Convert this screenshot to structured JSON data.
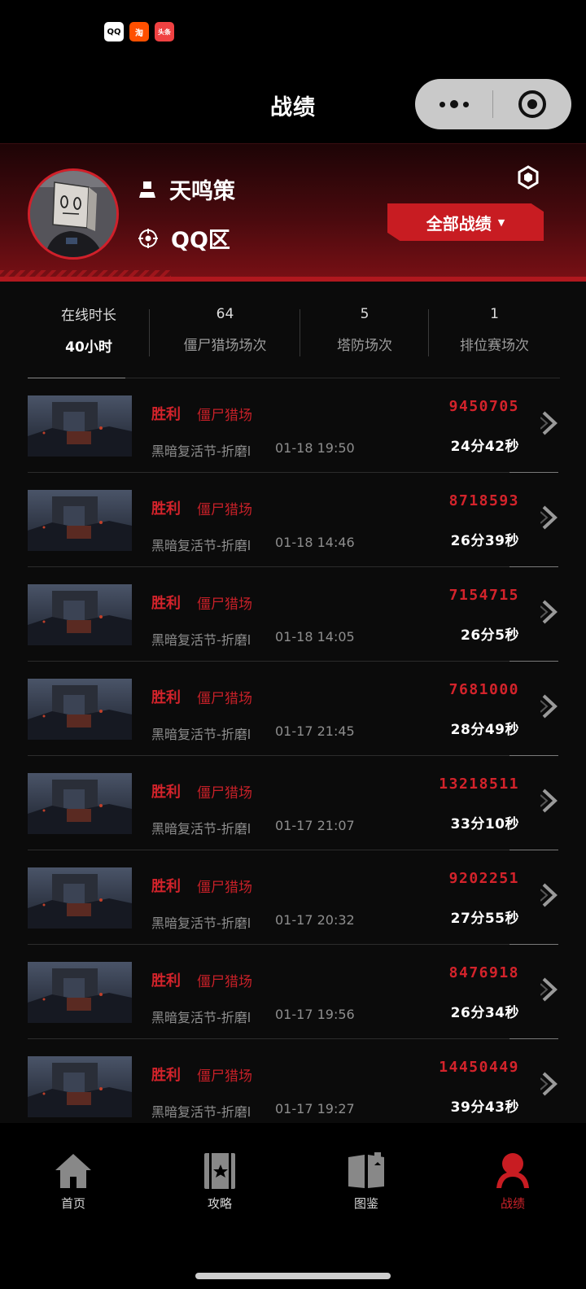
{
  "status_bar": {
    "icons": [
      {
        "name": "qq-app-icon",
        "text": "QQ"
      },
      {
        "name": "taobao-app-icon",
        "text": "淘"
      },
      {
        "name": "toutiao-app-icon",
        "text": "头条"
      }
    ]
  },
  "header": {
    "title": "战绩"
  },
  "profile": {
    "name": "天鸣策",
    "zone": "QQ区",
    "filter_button": "全部战绩",
    "filter_caret": "▼"
  },
  "stats": [
    {
      "label": "在线时长",
      "value": "40小时"
    },
    {
      "value": "64",
      "label": "僵尸猎场场次"
    },
    {
      "value": "5",
      "label": "塔防场次"
    },
    {
      "value": "1",
      "label": "排位赛场次"
    }
  ],
  "matches": [
    {
      "result": "胜利",
      "mode": "僵尸猎场",
      "map": "黑暗复活节-折磨l",
      "time": "01-18 19:50",
      "score": "9450705",
      "duration": "24分42秒"
    },
    {
      "result": "胜利",
      "mode": "僵尸猎场",
      "map": "黑暗复活节-折磨l",
      "time": "01-18 14:46",
      "score": "8718593",
      "duration": "26分39秒"
    },
    {
      "result": "胜利",
      "mode": "僵尸猎场",
      "map": "黑暗复活节-折磨l",
      "time": "01-18 14:05",
      "score": "7154715",
      "duration": "26分5秒"
    },
    {
      "result": "胜利",
      "mode": "僵尸猎场",
      "map": "黑暗复活节-折磨l",
      "time": "01-17 21:45",
      "score": "7681000",
      "duration": "28分49秒"
    },
    {
      "result": "胜利",
      "mode": "僵尸猎场",
      "map": "黑暗复活节-折磨l",
      "time": "01-17 21:07",
      "score": "13218511",
      "duration": "33分10秒"
    },
    {
      "result": "胜利",
      "mode": "僵尸猎场",
      "map": "黑暗复活节-折磨l",
      "time": "01-17 20:32",
      "score": "9202251",
      "duration": "27分55秒"
    },
    {
      "result": "胜利",
      "mode": "僵尸猎场",
      "map": "黑暗复活节-折磨l",
      "time": "01-17 19:56",
      "score": "8476918",
      "duration": "26分34秒"
    },
    {
      "result": "胜利",
      "mode": "僵尸猎场",
      "map": "黑暗复活节-折磨l",
      "time": "01-17 19:27",
      "score": "14450449",
      "duration": "39分43秒"
    }
  ],
  "tabbar": [
    {
      "label": "首页",
      "icon": "home-icon"
    },
    {
      "label": "攻略",
      "icon": "guide-icon"
    },
    {
      "label": "图鉴",
      "icon": "book-icon"
    },
    {
      "label": "战绩",
      "icon": "record-person-icon",
      "active": true
    }
  ],
  "colors": {
    "accent": "#d3232b",
    "background": "#0b0b0b",
    "header_gradient": "#7a1015"
  }
}
